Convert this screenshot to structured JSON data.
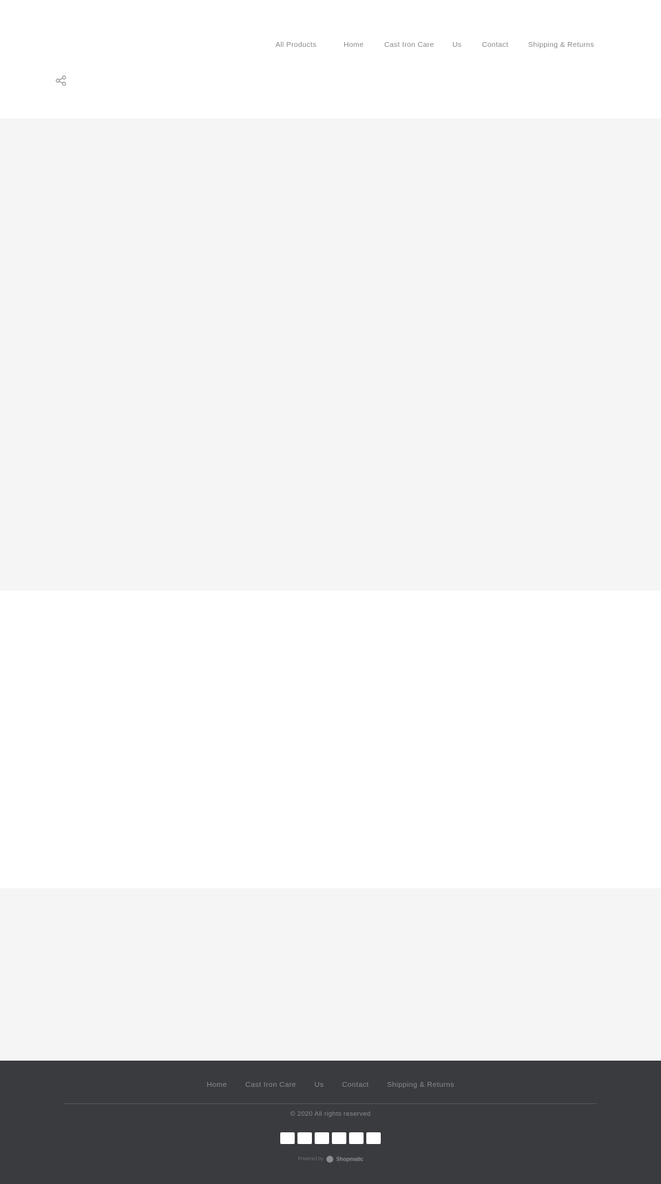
{
  "header": {
    "nav": [
      {
        "label": "All Products"
      },
      {
        "label": "Home"
      },
      {
        "label": "Cast Iron Care"
      },
      {
        "label": "Us"
      },
      {
        "label": "Contact"
      },
      {
        "label": "Shipping & Returns"
      }
    ],
    "share_icon": "share-icon"
  },
  "sections": {
    "colors": {
      "gray": "#f5f5f5",
      "white": "#ffffff"
    }
  },
  "footer": {
    "background": "#3a3b3f",
    "nav": [
      {
        "label": "Home"
      },
      {
        "label": "Cast Iron Care"
      },
      {
        "label": "Us"
      },
      {
        "label": "Contact"
      },
      {
        "label": "Shipping & Returns"
      }
    ],
    "copyright": "© 2020 All rights reserved",
    "payment_methods_count": 6,
    "powered_by_prefix": "Powered by",
    "powered_by_brand": "Shopmatic"
  }
}
